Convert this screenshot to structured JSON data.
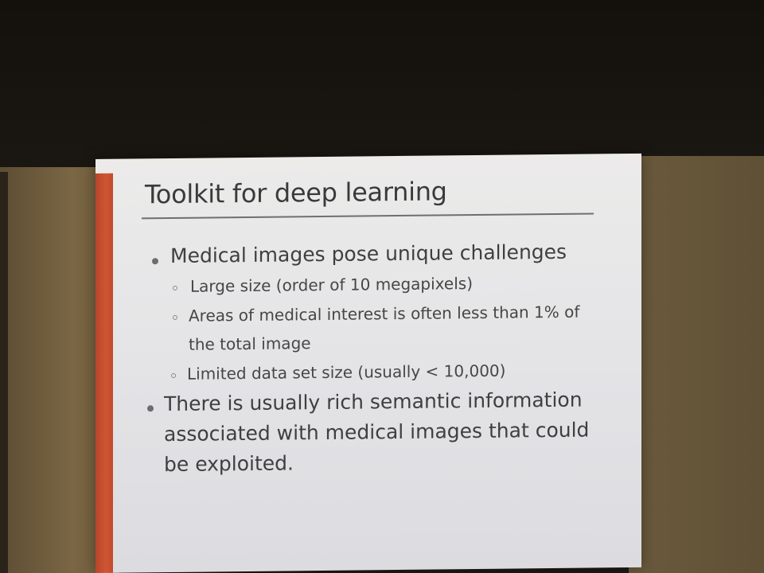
{
  "slide": {
    "title": "Toolkit for deep learning",
    "bullets": [
      {
        "text": "Medical images pose unique challenges",
        "subbullets": [
          "Large size (order of 10 megapixels)",
          "Areas of medical interest is often less than 1% of the total image",
          "Limited data set size (usually < 10,000)"
        ]
      },
      {
        "text": "There is usually rich semantic information associated with medical images that could be exploited.",
        "subbullets": []
      }
    ]
  },
  "colors": {
    "slide_background": "#e5e5e8",
    "accent_bar": "#cf5634",
    "text": "#3f3f3f",
    "wall": "#7a6644",
    "room": "#1a1611"
  }
}
